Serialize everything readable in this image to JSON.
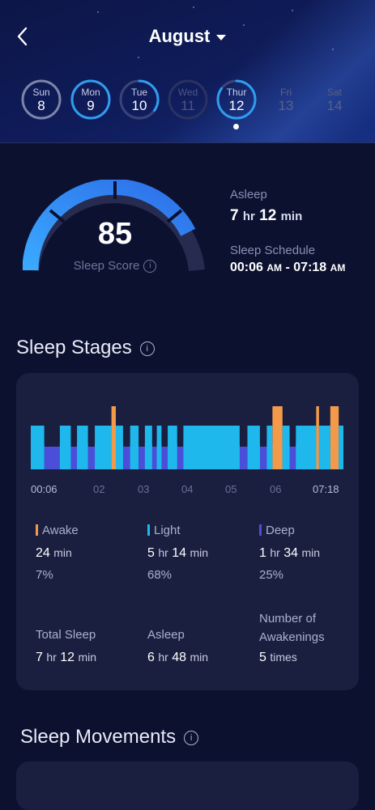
{
  "header": {
    "month": "August"
  },
  "days": [
    {
      "name": "Sun",
      "date": "8",
      "state": "past",
      "ring": 0
    },
    {
      "name": "Mon",
      "date": "9",
      "state": "done",
      "ring": 1.0
    },
    {
      "name": "Tue",
      "date": "10",
      "state": "partial",
      "ring": 0.35
    },
    {
      "name": "Wed",
      "date": "11",
      "state": "faded",
      "ring": 0
    },
    {
      "name": "Thur",
      "date": "12",
      "state": "selected",
      "ring": 0.85
    },
    {
      "name": "Fri",
      "date": "13",
      "state": "future",
      "ring": 0
    },
    {
      "name": "Sat",
      "date": "14",
      "state": "future",
      "ring": 0
    }
  ],
  "score": {
    "value": "85",
    "label": "Sleep Score",
    "fraction": 0.85
  },
  "summary": {
    "asleep_label": "Asleep",
    "asleep_hr": "7",
    "asleep_hr_unit": "hr",
    "asleep_min": "12",
    "asleep_min_unit": "min",
    "schedule_label": "Sleep Schedule",
    "schedule_start": "00:06",
    "schedule_start_ampm": "AM",
    "schedule_sep": "-",
    "schedule_end": "07:18",
    "schedule_end_ampm": "AM"
  },
  "stages": {
    "title": "Sleep Stages",
    "ticks": [
      "00:06",
      "02",
      "03",
      "04",
      "05",
      "06",
      "07:18"
    ],
    "awake": {
      "label": "Awake",
      "value": "24",
      "unit": "min",
      "pct": "7%"
    },
    "light": {
      "label": "Light",
      "hr": "5",
      "hr_unit": "hr",
      "min": "14",
      "min_unit": "min",
      "pct": "68%"
    },
    "deep": {
      "label": "Deep",
      "hr": "1",
      "hr_unit": "hr",
      "min": "34",
      "min_unit": "min",
      "pct": "25%"
    },
    "total": {
      "label": "Total Sleep",
      "hr": "7",
      "hr_unit": "hr",
      "min": "12",
      "min_unit": "min"
    },
    "asleep": {
      "label": "Asleep",
      "hr": "6",
      "hr_unit": "hr",
      "min": "48",
      "min_unit": "min"
    },
    "awakenings": {
      "label1": "Number of",
      "label2": "Awakenings",
      "value": "5",
      "unit": "times"
    },
    "colors": {
      "awake": "#f2994a",
      "light": "#1fb8ec",
      "deep": "#4a4ed8"
    }
  },
  "movements": {
    "title": "Sleep Movements"
  },
  "chart_data": {
    "type": "timeline",
    "x_start": "00:06",
    "x_end": "07:18",
    "segments": [
      {
        "stage": "light",
        "start": 0.0,
        "end": 0.043
      },
      {
        "stage": "deep",
        "start": 0.043,
        "end": 0.093
      },
      {
        "stage": "light",
        "start": 0.093,
        "end": 0.128
      },
      {
        "stage": "deep",
        "start": 0.128,
        "end": 0.148
      },
      {
        "stage": "light",
        "start": 0.148,
        "end": 0.183
      },
      {
        "stage": "deep",
        "start": 0.183,
        "end": 0.205
      },
      {
        "stage": "light",
        "start": 0.205,
        "end": 0.258
      },
      {
        "stage": "awake",
        "start": 0.258,
        "end": 0.272
      },
      {
        "stage": "light",
        "start": 0.272,
        "end": 0.295
      },
      {
        "stage": "deep",
        "start": 0.295,
        "end": 0.318
      },
      {
        "stage": "light",
        "start": 0.318,
        "end": 0.345
      },
      {
        "stage": "deep",
        "start": 0.345,
        "end": 0.365
      },
      {
        "stage": "light",
        "start": 0.365,
        "end": 0.388
      },
      {
        "stage": "deep",
        "start": 0.388,
        "end": 0.403
      },
      {
        "stage": "light",
        "start": 0.403,
        "end": 0.418
      },
      {
        "stage": "deep",
        "start": 0.418,
        "end": 0.438
      },
      {
        "stage": "light",
        "start": 0.438,
        "end": 0.468
      },
      {
        "stage": "deep",
        "start": 0.468,
        "end": 0.488
      },
      {
        "stage": "light",
        "start": 0.488,
        "end": 0.668
      },
      {
        "stage": "deep",
        "start": 0.668,
        "end": 0.693
      },
      {
        "stage": "light",
        "start": 0.693,
        "end": 0.733
      },
      {
        "stage": "deep",
        "start": 0.733,
        "end": 0.755
      },
      {
        "stage": "light",
        "start": 0.755,
        "end": 0.773
      },
      {
        "stage": "awake",
        "start": 0.773,
        "end": 0.805
      },
      {
        "stage": "light",
        "start": 0.805,
        "end": 0.828
      },
      {
        "stage": "deep",
        "start": 0.828,
        "end": 0.848
      },
      {
        "stage": "light",
        "start": 0.848,
        "end": 0.913
      },
      {
        "stage": "awake",
        "start": 0.913,
        "end": 0.922
      },
      {
        "stage": "light",
        "start": 0.922,
        "end": 0.958
      },
      {
        "stage": "awake",
        "start": 0.958,
        "end": 0.985
      },
      {
        "stage": "light",
        "start": 0.985,
        "end": 1.0
      }
    ]
  }
}
